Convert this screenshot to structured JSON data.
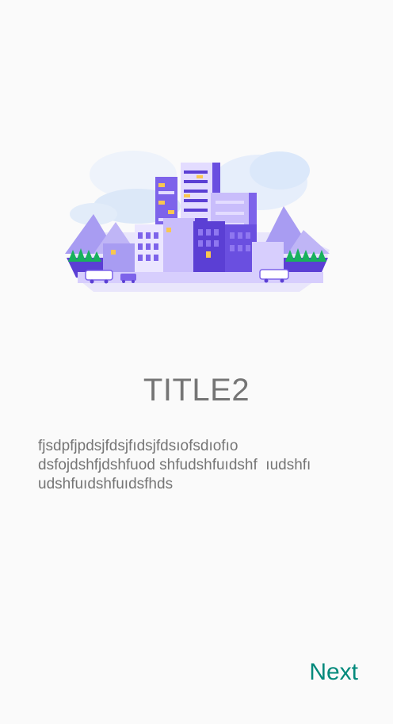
{
  "onboarding": {
    "illustration_icon": "city-skyline-illustration",
    "title": "TITLE2",
    "description_lines": [
      "fjsdpfjpdsjfdsjfıdsjfdsıofsdıofıo",
      "dsfojdshfjdshfuod shfudshfuıdshf  ıudshfı",
      "udshfuıdshfuıdsfhds"
    ],
    "next_label": "Next"
  },
  "colors": {
    "background": "#fafafa",
    "text": "#757575",
    "accent": "#00897b"
  }
}
